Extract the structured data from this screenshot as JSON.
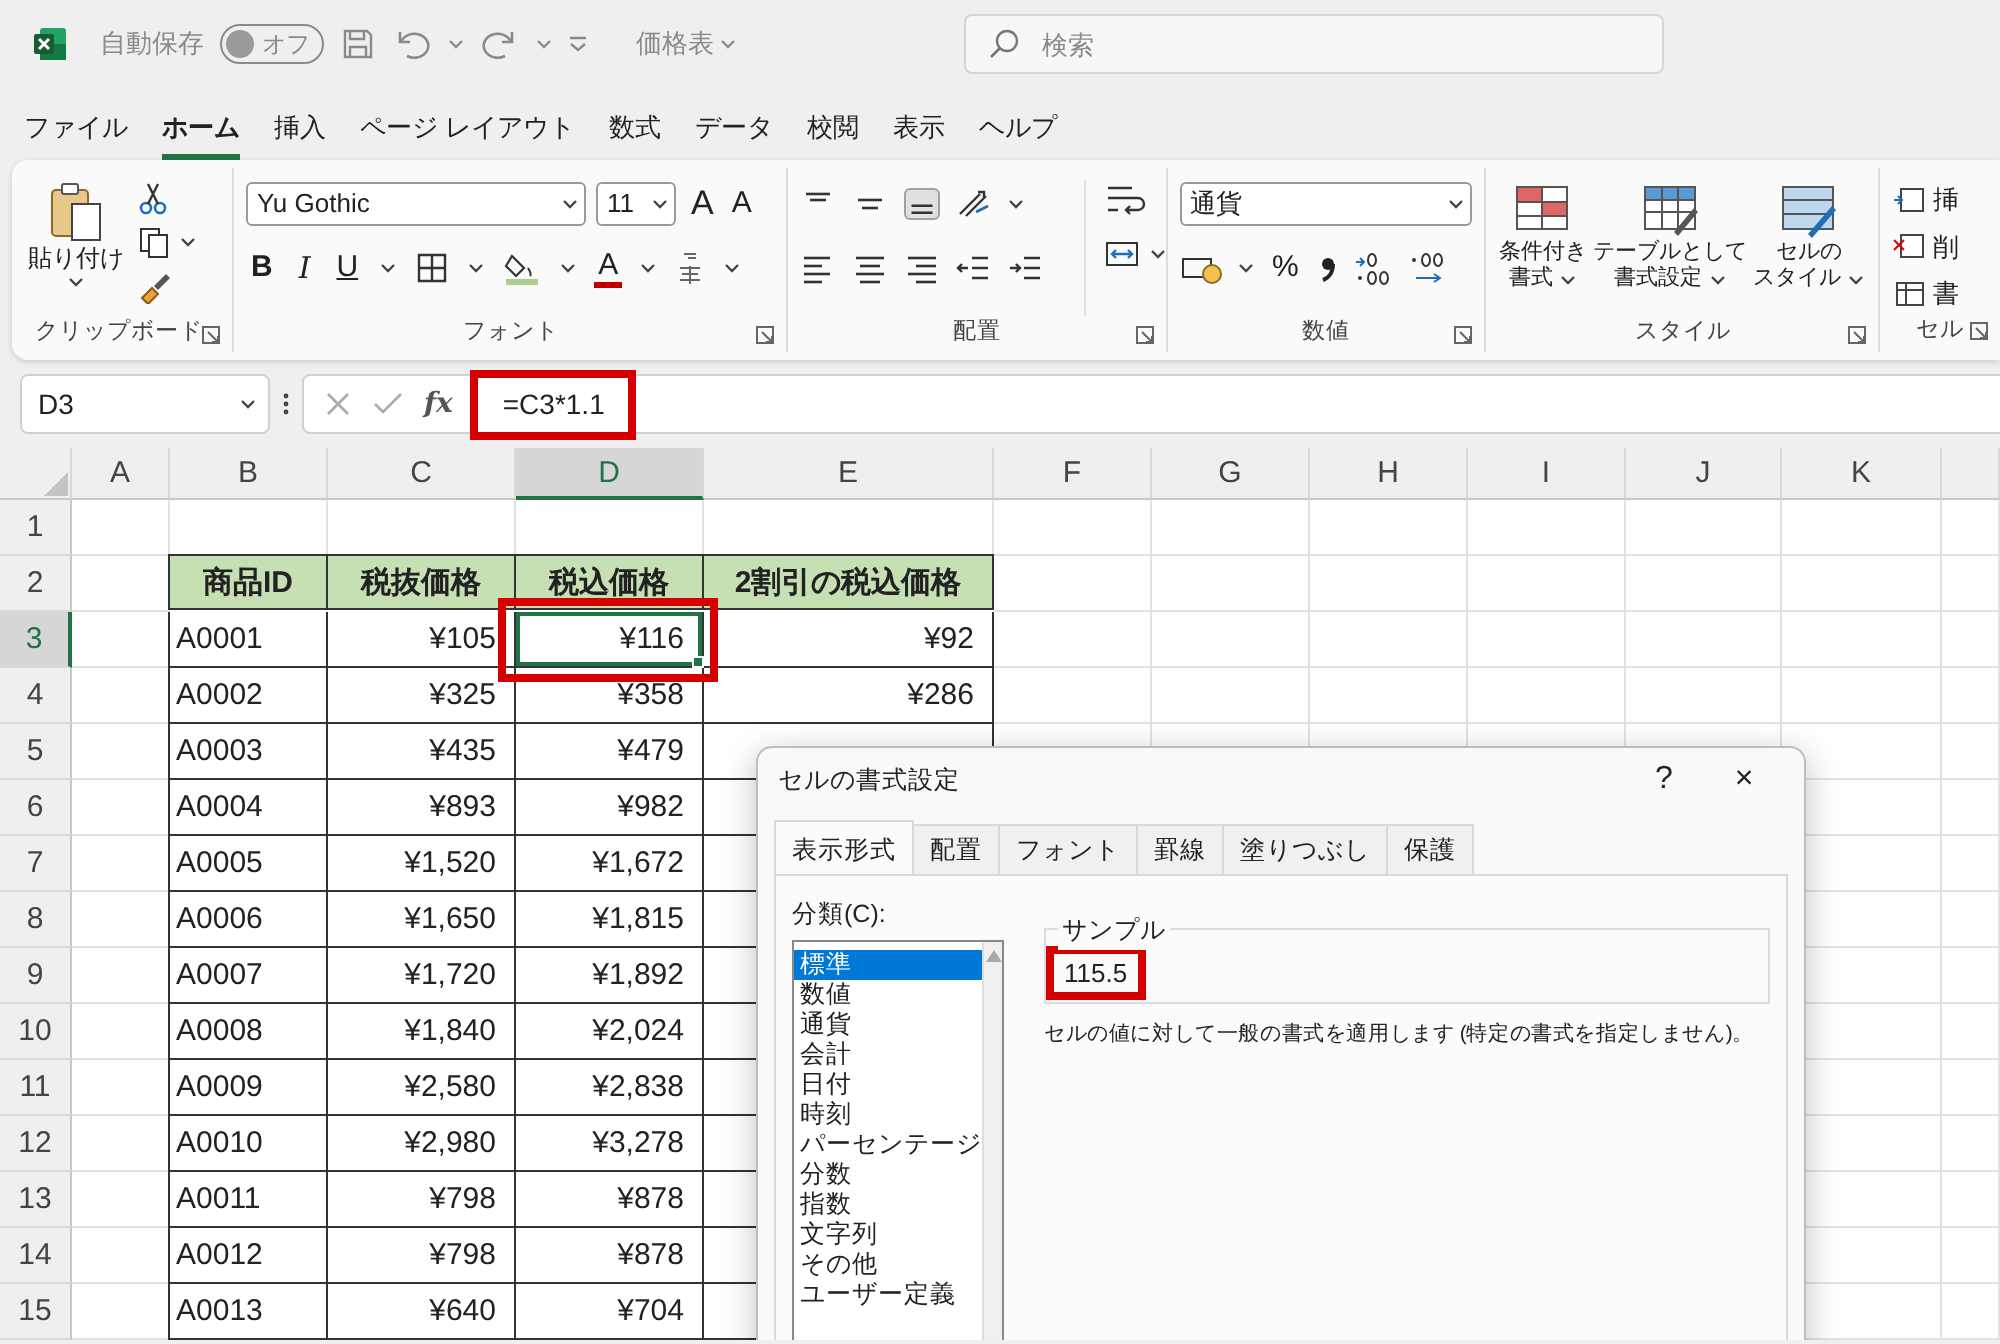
{
  "title_bar": {
    "autosave": {
      "label": "自動保存",
      "toggle_text": "オフ",
      "on": false
    },
    "file_name": "価格表",
    "search": {
      "placeholder": "検索"
    }
  },
  "menu_tabs": [
    {
      "label": "ファイル",
      "selected": false
    },
    {
      "label": "ホーム",
      "selected": true
    },
    {
      "label": "挿入",
      "selected": false
    },
    {
      "label": "ページ レイアウト",
      "selected": false
    },
    {
      "label": "数式",
      "selected": false
    },
    {
      "label": "データ",
      "selected": false
    },
    {
      "label": "校閲",
      "selected": false
    },
    {
      "label": "表示",
      "selected": false
    },
    {
      "label": "ヘルプ",
      "selected": false
    }
  ],
  "ribbon": {
    "clipboard": {
      "label": "クリップボード",
      "paste": "貼り付け"
    },
    "font": {
      "label": "フォント",
      "font_name": "Yu Gothic",
      "font_size": "11",
      "grow_font": "A",
      "shrink_font": "A",
      "bold": "B",
      "italic": "I",
      "underline": "U",
      "font_color": "A"
    },
    "alignment": {
      "label": "配置"
    },
    "number": {
      "label": "数値",
      "format": "通貨",
      "percent": "%"
    },
    "styles": {
      "label": "スタイル",
      "buttons": [
        {
          "lines": [
            "条件付き",
            "書式"
          ]
        },
        {
          "lines": [
            "テーブルとして",
            "書式設定"
          ]
        },
        {
          "lines": [
            "セルの",
            "スタイル"
          ]
        }
      ]
    },
    "cells": {
      "label": "セル",
      "buttons": [
        "挿",
        "削",
        "書"
      ]
    }
  },
  "formula_bar": {
    "name_box": "D3",
    "fx": "fx",
    "formula": "=C3*1.1",
    "highlighted": true
  },
  "sheet": {
    "columns": [
      {
        "label": "A",
        "selected": false
      },
      {
        "label": "B",
        "selected": false
      },
      {
        "label": "C",
        "selected": false
      },
      {
        "label": "D",
        "selected": true
      },
      {
        "label": "E",
        "selected": false
      },
      {
        "label": "F",
        "selected": false
      },
      {
        "label": "G",
        "selected": false
      },
      {
        "label": "H",
        "selected": false
      },
      {
        "label": "I",
        "selected": false
      },
      {
        "label": "J",
        "selected": false
      },
      {
        "label": "K",
        "selected": false
      }
    ],
    "rows": [
      {
        "number": "1",
        "selected": false,
        "cells": []
      },
      {
        "number": "2",
        "selected": false,
        "cells": [
          {
            "text": "",
            "kind": "blank"
          },
          {
            "text": "商品ID",
            "kind": "header"
          },
          {
            "text": "税抜価格",
            "kind": "header"
          },
          {
            "text": "税込価格",
            "kind": "header"
          },
          {
            "text": "2割引の税込価格",
            "kind": "header"
          }
        ]
      },
      {
        "number": "3",
        "selected": true,
        "cells": [
          {
            "text": "",
            "kind": "blank"
          },
          {
            "text": "A0001",
            "kind": "text"
          },
          {
            "text": "¥105",
            "kind": "number"
          },
          {
            "text": "¥116",
            "kind": "number",
            "active": true,
            "highlighted": true
          },
          {
            "text": "¥92",
            "kind": "number"
          }
        ]
      },
      {
        "number": "4",
        "selected": false,
        "cells": [
          {
            "text": "",
            "kind": "blank"
          },
          {
            "text": "A0002",
            "kind": "text"
          },
          {
            "text": "¥325",
            "kind": "number"
          },
          {
            "text": "¥358",
            "kind": "number"
          },
          {
            "text": "¥286",
            "kind": "number"
          }
        ]
      },
      {
        "number": "5",
        "selected": false,
        "cells": [
          {
            "text": "",
            "kind": "blank"
          },
          {
            "text": "A0003",
            "kind": "text"
          },
          {
            "text": "¥435",
            "kind": "number"
          },
          {
            "text": "¥479",
            "kind": "number"
          }
        ]
      },
      {
        "number": "6",
        "selected": false,
        "cells": [
          {
            "text": "",
            "kind": "blank"
          },
          {
            "text": "A0004",
            "kind": "text"
          },
          {
            "text": "¥893",
            "kind": "number"
          },
          {
            "text": "¥982",
            "kind": "number"
          }
        ]
      },
      {
        "number": "7",
        "selected": false,
        "cells": [
          {
            "text": "",
            "kind": "blank"
          },
          {
            "text": "A0005",
            "kind": "text"
          },
          {
            "text": "¥1,520",
            "kind": "number"
          },
          {
            "text": "¥1,672",
            "kind": "number"
          }
        ]
      },
      {
        "number": "8",
        "selected": false,
        "cells": [
          {
            "text": "",
            "kind": "blank"
          },
          {
            "text": "A0006",
            "kind": "text"
          },
          {
            "text": "¥1,650",
            "kind": "number"
          },
          {
            "text": "¥1,815",
            "kind": "number"
          }
        ]
      },
      {
        "number": "9",
        "selected": false,
        "cells": [
          {
            "text": "",
            "kind": "blank"
          },
          {
            "text": "A0007",
            "kind": "text"
          },
          {
            "text": "¥1,720",
            "kind": "number"
          },
          {
            "text": "¥1,892",
            "kind": "number"
          }
        ]
      },
      {
        "number": "10",
        "selected": false,
        "cells": [
          {
            "text": "",
            "kind": "blank"
          },
          {
            "text": "A0008",
            "kind": "text"
          },
          {
            "text": "¥1,840",
            "kind": "number"
          },
          {
            "text": "¥2,024",
            "kind": "number"
          }
        ]
      },
      {
        "number": "11",
        "selected": false,
        "cells": [
          {
            "text": "",
            "kind": "blank"
          },
          {
            "text": "A0009",
            "kind": "text"
          },
          {
            "text": "¥2,580",
            "kind": "number"
          },
          {
            "text": "¥2,838",
            "kind": "number"
          }
        ]
      },
      {
        "number": "12",
        "selected": false,
        "cells": [
          {
            "text": "",
            "kind": "blank"
          },
          {
            "text": "A0010",
            "kind": "text"
          },
          {
            "text": "¥2,980",
            "kind": "number"
          },
          {
            "text": "¥3,278",
            "kind": "number"
          }
        ]
      },
      {
        "number": "13",
        "selected": false,
        "cells": [
          {
            "text": "",
            "kind": "blank"
          },
          {
            "text": "A0011",
            "kind": "text"
          },
          {
            "text": "¥798",
            "kind": "number"
          },
          {
            "text": "¥878",
            "kind": "number"
          }
        ]
      },
      {
        "number": "14",
        "selected": false,
        "cells": [
          {
            "text": "",
            "kind": "blank"
          },
          {
            "text": "A0012",
            "kind": "text"
          },
          {
            "text": "¥798",
            "kind": "number"
          },
          {
            "text": "¥878",
            "kind": "number"
          }
        ]
      },
      {
        "number": "15",
        "selected": false,
        "cells": [
          {
            "text": "",
            "kind": "blank"
          },
          {
            "text": "A0013",
            "kind": "text"
          },
          {
            "text": "¥640",
            "kind": "number"
          },
          {
            "text": "¥704",
            "kind": "number"
          }
        ]
      }
    ]
  },
  "dialog": {
    "title": "セルの書式設定",
    "help": "?",
    "close": "×",
    "tabs": [
      {
        "label": "表示形式",
        "selected": true
      },
      {
        "label": "配置",
        "selected": false
      },
      {
        "label": "フォント",
        "selected": false
      },
      {
        "label": "罫線",
        "selected": false
      },
      {
        "label": "塗りつぶし",
        "selected": false
      },
      {
        "label": "保護",
        "selected": false
      }
    ],
    "category_label": "分類(C):",
    "categories": [
      {
        "label": "標準",
        "selected": true
      },
      {
        "label": "数値",
        "selected": false
      },
      {
        "label": "通貨",
        "selected": false
      },
      {
        "label": "会計",
        "selected": false
      },
      {
        "label": "日付",
        "selected": false
      },
      {
        "label": "時刻",
        "selected": false
      },
      {
        "label": "パーセンテージ",
        "selected": false
      },
      {
        "label": "分数",
        "selected": false
      },
      {
        "label": "指数",
        "selected": false
      },
      {
        "label": "文字列",
        "selected": false
      },
      {
        "label": "その他",
        "selected": false
      },
      {
        "label": "ユーザー定義",
        "selected": false
      }
    ],
    "sample": {
      "legend": "サンプル",
      "value": "115.5",
      "highlighted": true
    },
    "description": "セルの値に対して一般の書式を適用します (特定の書式を指定しません)。"
  }
}
